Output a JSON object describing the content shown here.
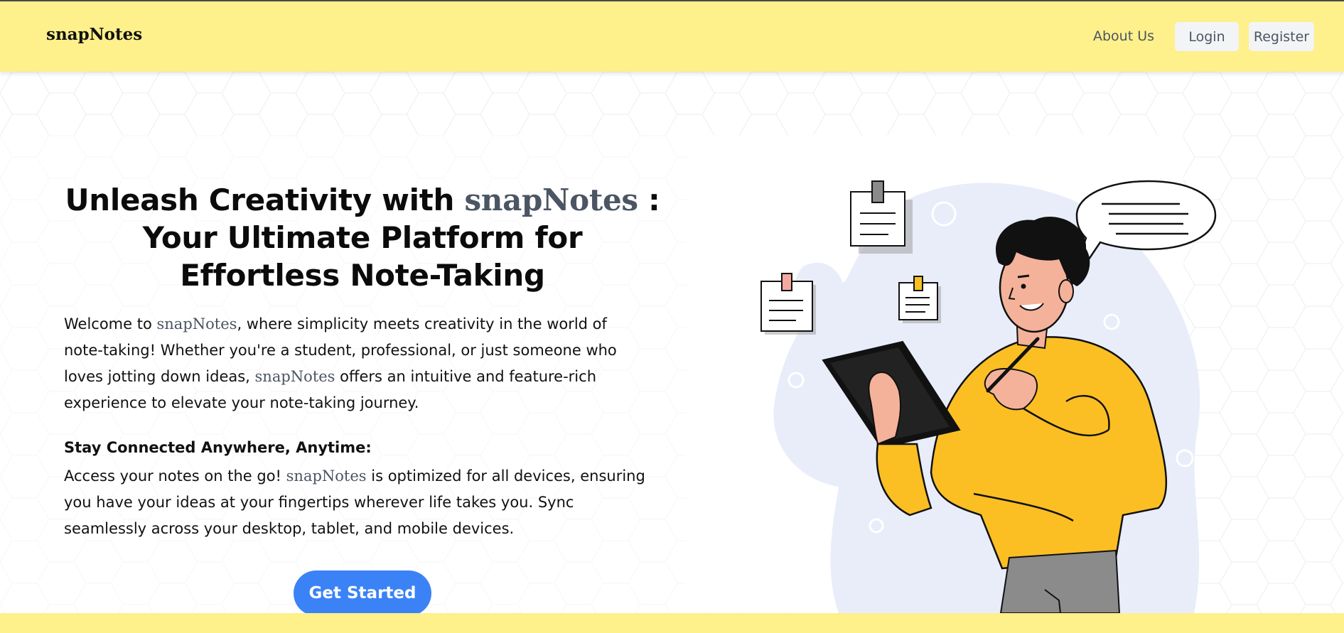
{
  "header": {
    "brand": "snapNotes",
    "nav": {
      "about": "About Us",
      "login": "Login",
      "register": "Register"
    }
  },
  "hero": {
    "title_part1": "Unleash Creativity with ",
    "title_brand": "snapNotes",
    "title_part2": " : Your Ultimate Platform for Effortless Note-Taking",
    "intro": {
      "before_brand_1": "Welcome to ",
      "brand_1": "snapNotes",
      "middle": ", where simplicity meets creativity in the world of note-taking! Whether you're a student, professional, or just someone who loves jotting down ideas, ",
      "brand_2": "snapNotes",
      "after": " offers an intuitive and feature-rich experience to elevate your note-taking journey."
    },
    "section_heading": "Stay Connected Anywhere, Anytime:",
    "section": {
      "before_brand": "Access your notes on the go! ",
      "brand": "snapNotes",
      "after": " is optimized for all devices, ensuring you have your ideas at your fingertips wherever life takes you. Sync seamlessly across your desktop, tablet, and mobile devices."
    },
    "cta_label": "Get Started"
  },
  "colors": {
    "header_bg": "#fef08a",
    "accent_blue": "#3b82f6",
    "brand_gray": "#4b5563",
    "illustration_yellow": "#fbbf24",
    "illustration_blob": "#e8edf9"
  },
  "illustration": {
    "icon": "person-with-tablet-illustration"
  }
}
